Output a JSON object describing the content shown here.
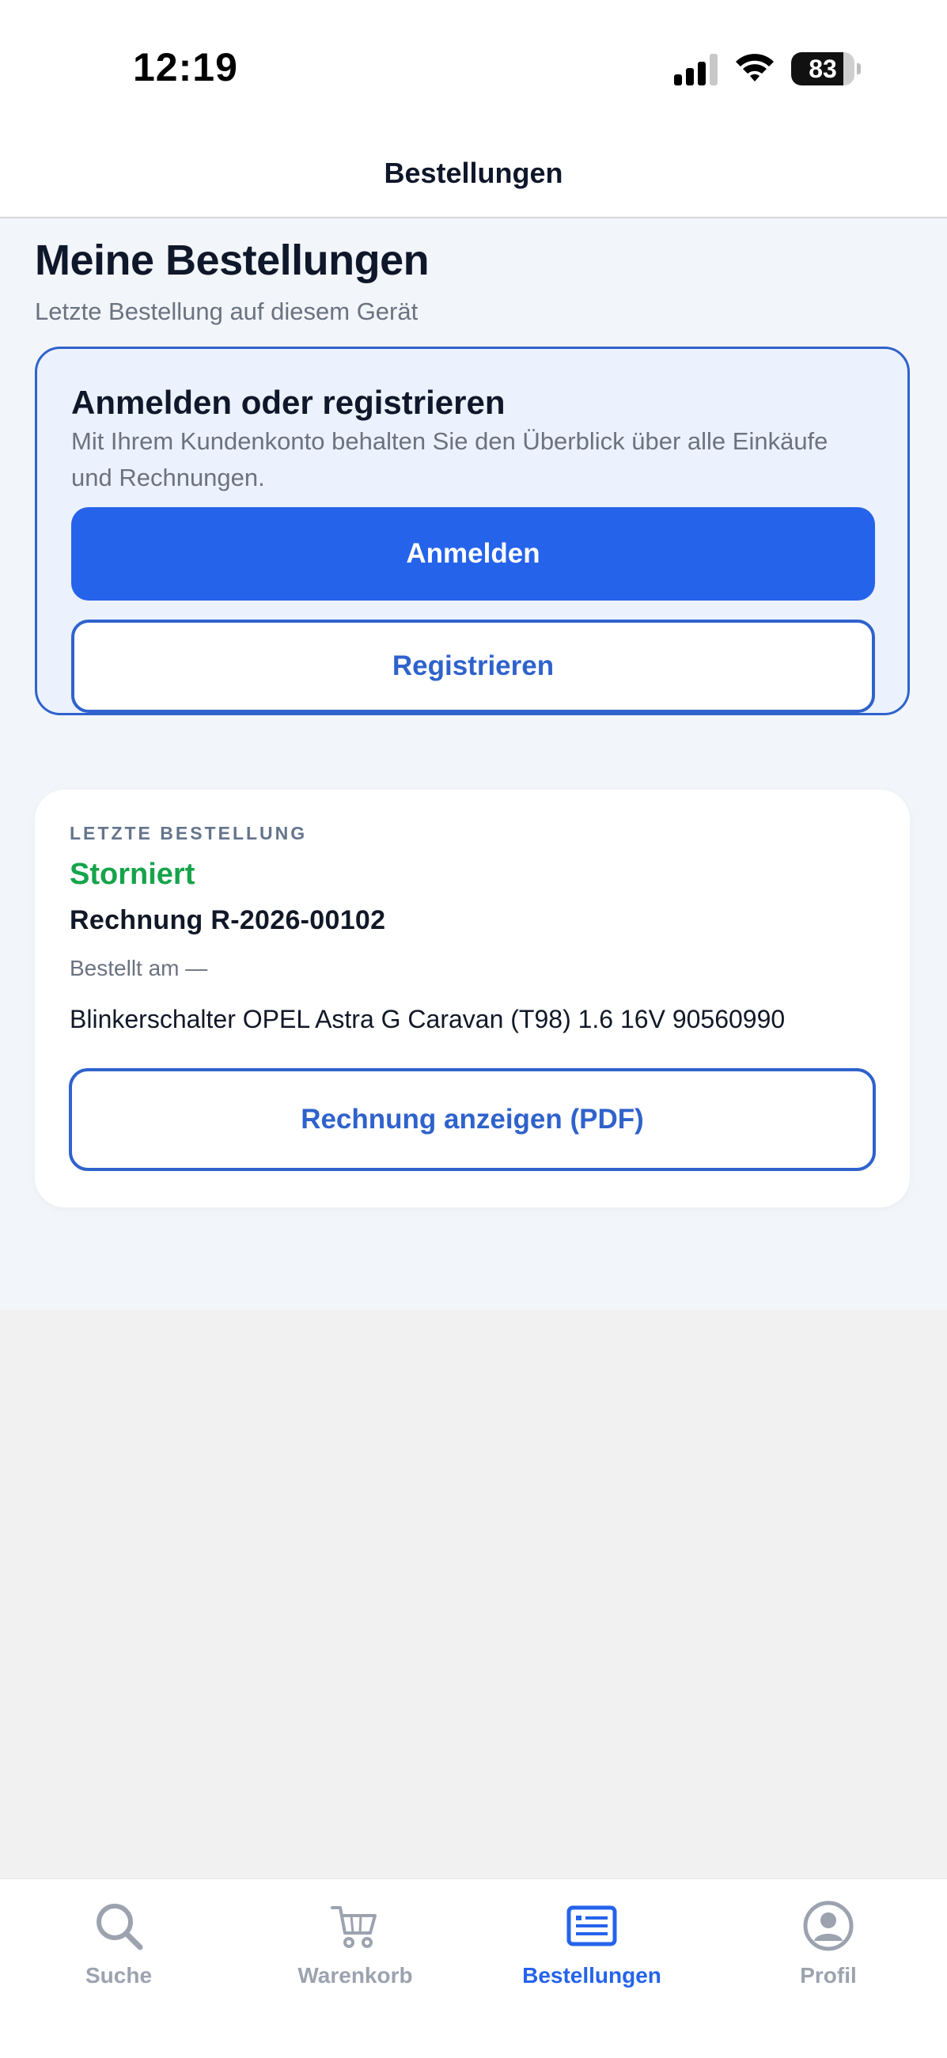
{
  "status_bar": {
    "time": "12:19",
    "battery_percent": "83"
  },
  "navbar": {
    "title": "Bestellungen"
  },
  "page": {
    "title": "Meine Bestellungen",
    "subtitle": "Letzte Bestellung auf diesem Gerät"
  },
  "login_card": {
    "heading": "Anmelden oder registrieren",
    "description": "Mit Ihrem Kundenkonto behalten Sie den Überblick über alle Einkäufe und Rechnungen.",
    "login_label": "Anmelden",
    "register_label": "Registrieren"
  },
  "order_card": {
    "eyebrow": "LETZTE BESTELLUNG",
    "status": "Storniert",
    "invoice": "Rechnung R-2026-00102",
    "ordered_at": "Bestellt am —",
    "product": "Blinkerschalter OPEL Astra G Caravan (T98) 1.6 16V 90560990",
    "pdf_button_label": "Rechnung anzeigen (PDF)"
  },
  "tabbar": {
    "tabs": [
      {
        "label": "Suche",
        "icon": "search-icon",
        "active": false
      },
      {
        "label": "Warenkorb",
        "icon": "cart-icon",
        "active": false
      },
      {
        "label": "Bestellungen",
        "icon": "orders-icon",
        "active": true
      },
      {
        "label": "Profil",
        "icon": "profile-icon",
        "active": false
      }
    ]
  },
  "colors": {
    "accent": "#2563eb",
    "status_cancelled": "#16a34a",
    "inactive_tab": "#9ca3af"
  }
}
